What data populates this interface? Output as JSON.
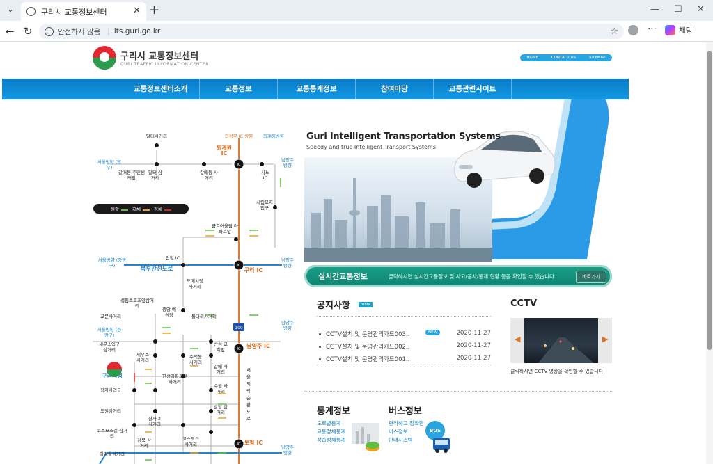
{
  "browser": {
    "tab_title": "구리시 교통정보센터",
    "url_warning": "안전하지 않음",
    "url": "its.guri.go.kr",
    "copilot_label": "채팅"
  },
  "site": {
    "logo_ko": "구리시 교통정보센터",
    "logo_en": "GURI TRAFFIC INFORMATION CENTER",
    "toplinks": [
      "HOME",
      "CONTACT US",
      "SITEMAP"
    ],
    "menu": [
      "교통정보센터소개",
      "교통정보",
      "교통통계정보",
      "참여마당",
      "교통관련사이트"
    ],
    "hero_title": "Guri Intelligent Transportation Systems",
    "hero_sub": "Speedy and true Intelligent Transport Systems",
    "realtime_title": "실시간교통정보",
    "realtime_desc": "클릭하시면 실시간교통정보 및 사고/공사/통제 현황 등을 확인할 수 있습니다",
    "realtime_button": "바로가기",
    "notice_title": "공지사항",
    "notice_more": "more",
    "notices": [
      {
        "title": "CCTV설치 및 운영관리카드003..",
        "date": "2020-11-27",
        "new": "NEW"
      },
      {
        "title": "CCTV설치 및 운영관리카드002..",
        "date": "2020-11-27"
      },
      {
        "title": "CCTV설치 및 운영관리카드001..",
        "date": "2020-11-27"
      }
    ],
    "cctv_title": "CCTV",
    "cctv_caption": "클릭하시면 CCTV 영상을 확인할 수 있습니다",
    "stat_title": "통계정보",
    "stat_links": [
      "도로별통계",
      "교통정체통계",
      "상습정체통계"
    ],
    "bus_title": "버스정보",
    "bus_links": [
      "편리하고 정확한",
      "버스정보",
      "안내시스템"
    ],
    "bus_badge": "BUS"
  },
  "legend": {
    "smooth": "원활",
    "slow": "지체",
    "jam": "정체"
  },
  "legend_colors": {
    "smooth": "#5fc040",
    "slow": "#f0a020",
    "jam": "#e02020"
  },
  "map": {
    "labels": {
      "dalteo": "달터사거리",
      "uijeongbu": "의정부 IC 방향",
      "toegyewon_dir": "퇴계원방향",
      "toegyewon": "퇴계원 IC",
      "seoul_mangu": "서울방향 (망우)",
      "galmae_center": "갈매동 주민센터앞",
      "dalteo2": "달터 삼거리",
      "galmae": "갈매동 사거리",
      "sano": "사노 IC",
      "namyang1": "남양주 방향",
      "cemetery": "시립묘지 입구",
      "geumho": "금호어울림 아파트앞",
      "seoul_jungrang": "서울방향 (중랑구)",
      "inchang": "인창 IC",
      "bukbu": "북부간선도로",
      "guri_ic": "구리 IC",
      "namyang2": "남양주 방향",
      "domae": "도매시장 사거리",
      "sports": "성림스포츠앞삼거리",
      "market": "중앙 예식장",
      "gyomun": "교문사거리",
      "dolda": "돌다리사거리",
      "seoul_jungrang2": "서울방향 (중랑구)",
      "namyang3": "남양주 방향",
      "semusu1": "세무소입구 삼거리",
      "semusu2": "세무소 사거리",
      "banseok": "반석 교회앞",
      "namyang_ic": "남양주 IC",
      "sutaek": "수택동 사거리",
      "galmae2": "갈매 사거리",
      "gurihall": "구리시청",
      "hansung": "한성아파트앞 사거리",
      "jangja": "장자사업구",
      "suwon": "수원 사거리",
      "dowon": "도원삼거리",
      "jangja2": "장자 2 사거리",
      "balbal": "발발 삼거리",
      "cosmos1": "코스모스길 삼거리",
      "cosmos2": "코스모스 사거리",
      "gangbuk": "강북 삼거리",
      "toepyeong": "토평 IC",
      "ahaemol": "아치울삼거리",
      "namyang4": "남양주 방향",
      "ring": "서울외곽순환도로",
      "route100": "100"
    }
  }
}
